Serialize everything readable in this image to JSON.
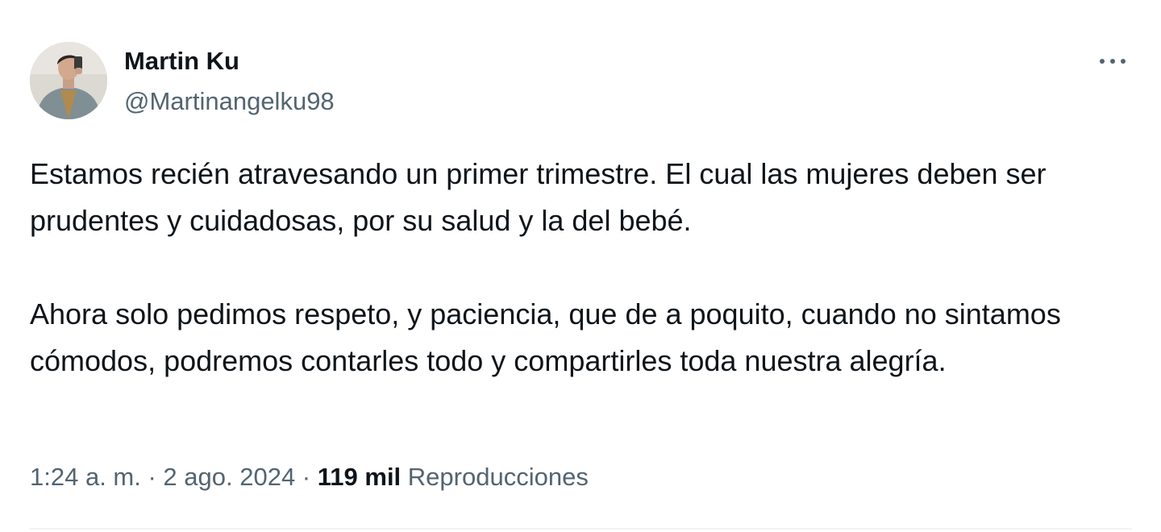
{
  "author": {
    "name": "Martin Ku",
    "handle": "@Martinangelku98"
  },
  "tweet": {
    "paragraphs": [
      "Estamos recién atravesando un primer trimestre. El cual las mujeres deben ser prudentes y cuidadosas, por su salud y la del bebé.",
      "Ahora solo pedimos respeto, y paciencia, que de a poquito, cuando no sintamos cómodos, podremos contarles todo y compartirles toda nuestra alegría."
    ]
  },
  "meta": {
    "time": "1:24 a. m.",
    "separator": " · ",
    "date": "2 ago. 2024",
    "views_count": "119 mil",
    "views_label": "Reproducciones"
  },
  "icons": {
    "more": "more-horizontal-icon"
  },
  "colors": {
    "primary_text": "#0f1419",
    "secondary_text": "#536471",
    "divider": "#eff3f4"
  }
}
